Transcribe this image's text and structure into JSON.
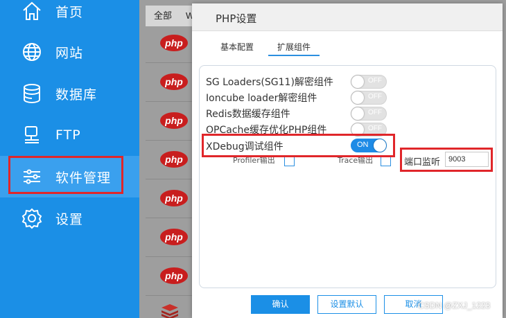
{
  "sidebar": {
    "items": [
      {
        "label": "首页",
        "icon": "home-icon"
      },
      {
        "label": "网站",
        "icon": "globe-icon"
      },
      {
        "label": "数据库",
        "icon": "database-icon"
      },
      {
        "label": "FTP",
        "icon": "monitor-icon"
      },
      {
        "label": "软件管理",
        "icon": "sliders-icon",
        "active": true
      },
      {
        "label": "设置",
        "icon": "gear-icon"
      }
    ]
  },
  "background": {
    "tabs": [
      "全部",
      "W"
    ],
    "row_logo_text": "php"
  },
  "dialog": {
    "title": "PHP设置",
    "tabs": [
      {
        "label": "基本配置",
        "active": false
      },
      {
        "label": "扩展组件",
        "active": true
      }
    ],
    "components": [
      {
        "label": "SG Loaders(SG11)解密组件",
        "state": "OFF"
      },
      {
        "label": "Ioncube loader解密组件",
        "state": "OFF"
      },
      {
        "label": "Redis数据缓存组件",
        "state": "OFF"
      },
      {
        "label": "OPCache缓存优化PHP组件",
        "state": "OFF"
      },
      {
        "label": "XDebug调试组件",
        "state": "ON"
      }
    ],
    "xdebug_options": {
      "profiler_label": "Profiler输出",
      "trace_label": "Trace输出",
      "port_label": "端口监听",
      "port_value": "9003"
    },
    "buttons": {
      "confirm": "确认",
      "reset": "设置默认",
      "cancel": "取消"
    }
  },
  "watermark": "CSDN @ZXJ_1223",
  "colors": {
    "sidebar": "#1b8fe6",
    "accent": "#1e8be6",
    "highlight": "#e0262a",
    "php_logo": "#c81e1e"
  }
}
